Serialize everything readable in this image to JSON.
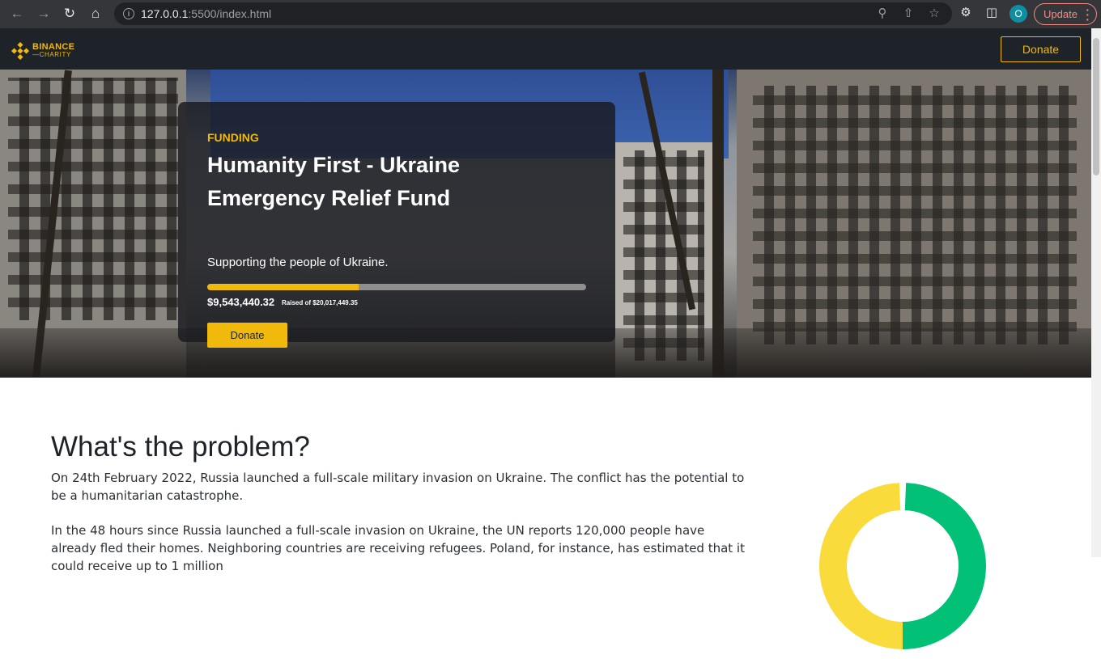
{
  "browser": {
    "url_host": "127.0.0.1",
    "url_rest": ":5500/index.html",
    "profile_initial": "O",
    "update_label": "Update"
  },
  "header": {
    "logo_line1": "BINANCE",
    "logo_line2": "CHARITY",
    "donate_label": "Donate",
    "accent_color": "#f0b90b"
  },
  "hero": {
    "kicker": "FUNDING",
    "title": "Humanity First - Ukraine Emergency Relief Fund",
    "subtitle": "Supporting the people of Ukraine.",
    "raised": "$9,543,440.32",
    "raised_of": "Raised of $20,017,449.35",
    "progress_fraction": 0.4,
    "donate_label": "Donate"
  },
  "content": {
    "title": "What's the problem?",
    "paragraph1": "On 24th February 2022, Russia launched a full-scale military invasion on Ukraine. The conflict has the potential to be a humanitarian catastrophe.",
    "paragraph2": "In the 48 hours since Russia launched a full-scale invasion on Ukraine, the UN reports 120,000 people have already fled their homes. Neighboring countries are receiving refugees. Poland, for instance, has estimated that it could receive up to 1 million"
  },
  "chart_data": {
    "type": "pie",
    "style": "donut",
    "colors": [
      "#02c076",
      "#fadb3c"
    ]
  }
}
